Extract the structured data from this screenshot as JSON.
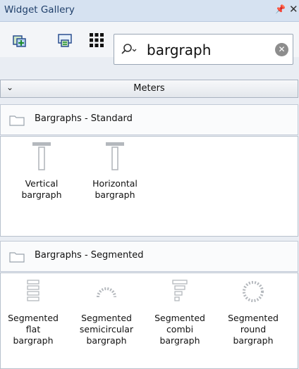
{
  "window": {
    "title": "Widget Gallery",
    "pin_glyph": "📌",
    "close_glyph": "✕"
  },
  "toolbar": {
    "buttons": [
      {
        "icon": "add-widget-icon"
      },
      {
        "icon": "replace-widget-icon"
      },
      {
        "icon": "grid-view-icon"
      }
    ],
    "search": {
      "value": "bargraph",
      "clear_glyph": "✕"
    }
  },
  "category": {
    "label": "Meters",
    "chevron": "⌄"
  },
  "groups": [
    {
      "name": "Bargraphs - Standard",
      "items": [
        {
          "line1": "Vertical",
          "line2": "bargraph",
          "line3": ""
        },
        {
          "line1": "Horizontal",
          "line2": "bargraph",
          "line3": ""
        }
      ]
    },
    {
      "name": "Bargraphs - Segmented",
      "items": [
        {
          "line1": "Segmented",
          "line2": "flat",
          "line3": "bargraph"
        },
        {
          "line1": "Segmented",
          "line2": "semicircular",
          "line3": "bargraph"
        },
        {
          "line1": "Segmented",
          "line2": "combi",
          "line3": "bargraph"
        },
        {
          "line1": "Segmented",
          "line2": "round",
          "line3": "bargraph"
        }
      ]
    }
  ],
  "colors": {
    "titlebar": "#d6e2f1",
    "title_text": "#1f3f6a",
    "panel_bg": "#e9edf3",
    "icon_grey": "#b4b8bd"
  }
}
